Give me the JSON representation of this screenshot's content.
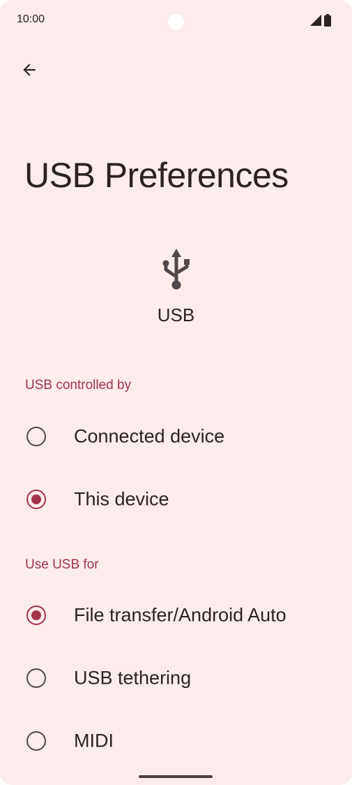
{
  "status_bar": {
    "time": "10:00",
    "icons": [
      "signal-icon",
      "battery-icon"
    ]
  },
  "toolbar": {
    "back_icon": "arrow-back-icon"
  },
  "page": {
    "title": "USB Preferences"
  },
  "usb_header": {
    "icon": "usb-icon",
    "label": "USB"
  },
  "sections": {
    "controlled_by": {
      "title": "USB controlled by",
      "options": [
        {
          "label": "Connected device",
          "selected": false
        },
        {
          "label": "This device",
          "selected": true
        }
      ]
    },
    "use_for": {
      "title": "Use USB for",
      "options": [
        {
          "label": "File transfer/Android Auto",
          "selected": true
        },
        {
          "label": "USB tethering",
          "selected": false
        },
        {
          "label": "MIDI",
          "selected": false
        }
      ]
    }
  },
  "colors": {
    "background": "#fcecec",
    "accent": "#a2344b",
    "text": "#2b2224"
  }
}
